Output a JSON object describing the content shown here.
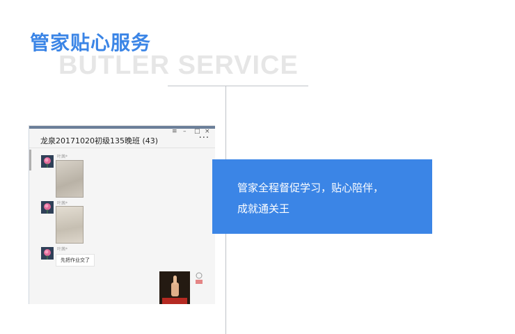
{
  "header": {
    "title_cn": "管家贴心服务",
    "title_en": "BUTLER SERVICE"
  },
  "chat_window": {
    "title": "龙泉20171020初级135晚班 (43)",
    "controls": {
      "pin": "≡",
      "minimize": "–",
      "maximize": "□",
      "close": "×"
    },
    "more": "···",
    "messages": [
      {
        "sender": "叶茜*",
        "type": "image"
      },
      {
        "sender": "叶茜*",
        "type": "image"
      },
      {
        "sender": "叶茜*",
        "type": "text",
        "text": "先把作业交了"
      }
    ]
  },
  "callout": {
    "line1": "管家全程督促学习，贴心陪伴，",
    "line2": "成就通关王"
  },
  "colors": {
    "accent": "#3b85e6",
    "watermark": "#e6e6e6"
  }
}
